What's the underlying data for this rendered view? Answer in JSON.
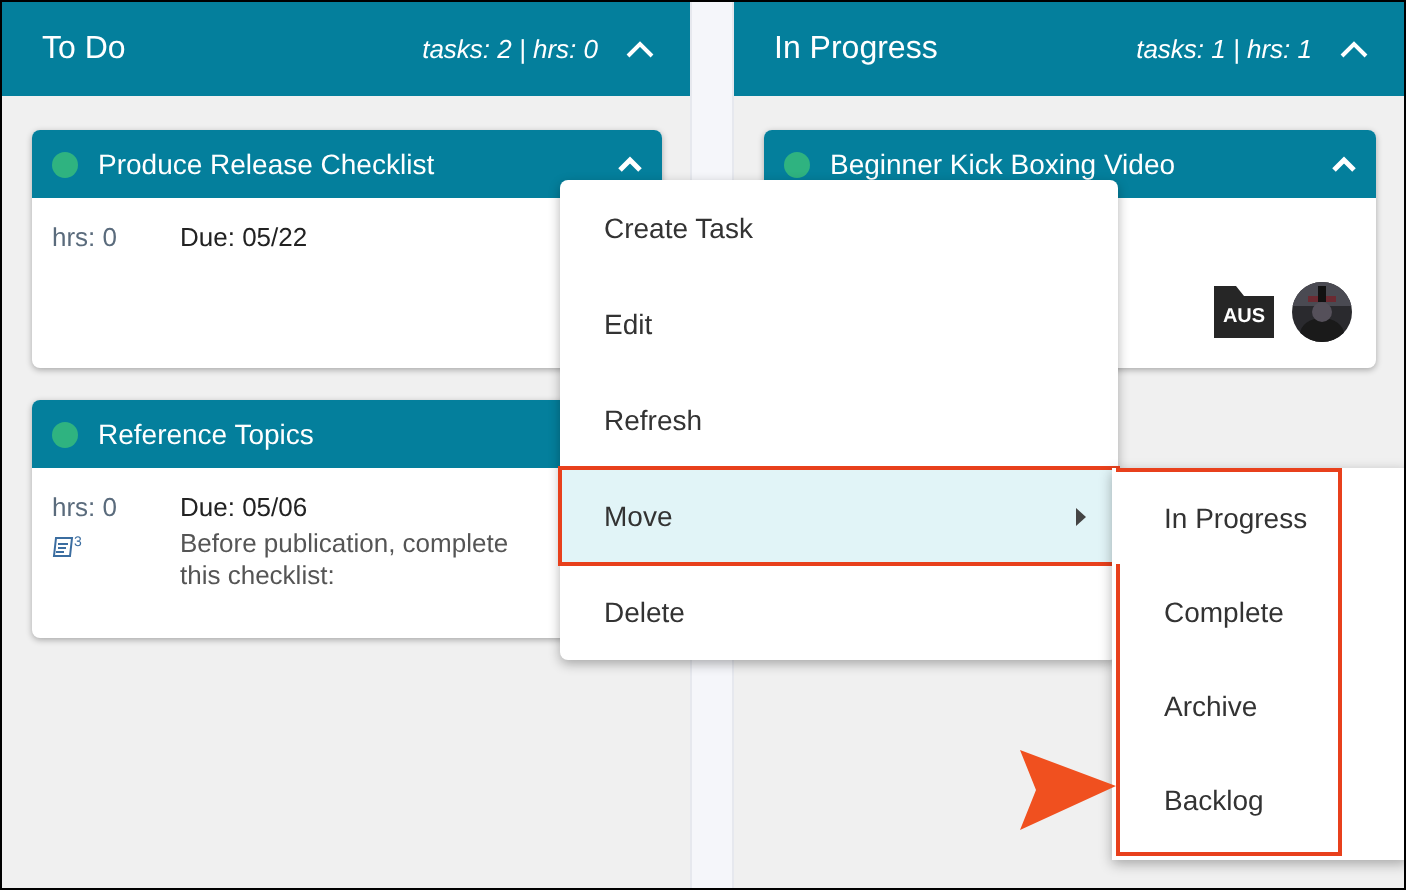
{
  "columns": [
    {
      "title": "To Do",
      "stats": "tasks: 2 | hrs: 0",
      "cards": [
        {
          "title": "Produce Release Checklist",
          "hours": "hrs: 0",
          "due": "Due: 05/22",
          "expanded": true
        },
        {
          "title": "Reference Topics",
          "hours": "hrs: 0",
          "due": "Due: 05/06",
          "description": "Before publication, complete this checklist:",
          "notes_count": "3"
        }
      ]
    },
    {
      "title": "In Progress",
      "stats": "tasks: 1 | hrs: 1",
      "cards": [
        {
          "title": "Beginner Kick Boxing Video",
          "tag": "AUS",
          "has_avatar": true,
          "expanded": true
        }
      ]
    }
  ],
  "context_menu": [
    {
      "label": "Create Task",
      "selected": false
    },
    {
      "label": "Edit",
      "selected": false
    },
    {
      "label": "Refresh",
      "selected": false
    },
    {
      "label": "Move",
      "selected": true,
      "kind": "submenu"
    },
    {
      "label": "Delete",
      "selected": false
    }
  ],
  "submenu": [
    {
      "label": "In Progress"
    },
    {
      "label": "Complete"
    },
    {
      "label": "Archive"
    },
    {
      "label": "Backlog"
    }
  ]
}
